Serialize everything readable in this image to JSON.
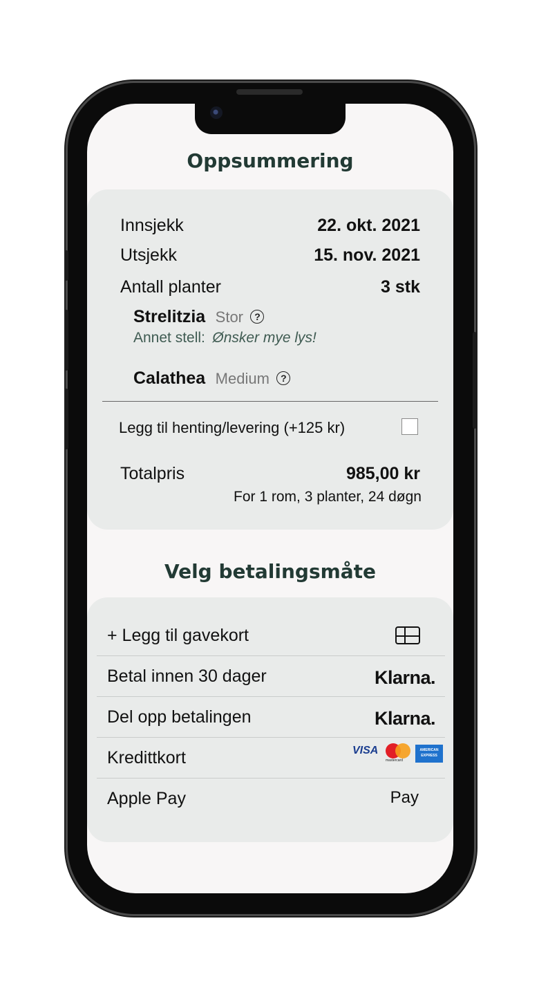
{
  "summary": {
    "title": "Oppsummering",
    "checkin_label": "Innsjekk",
    "checkin_value": "22. okt. 2021",
    "checkout_label": "Utsjekk",
    "checkout_value": "15. nov. 2021",
    "plants_label": "Antall planter",
    "plants_value": "3 stk",
    "plant1_name": "Strelitzia",
    "plant1_size": "Stor",
    "plant1_care_label": "Annet stell:",
    "plant1_care_value": "Ønsker mye lys!",
    "plant2_name": "Calathea",
    "plant2_size": "Medium",
    "help_glyph": "?",
    "pickup_label": "Legg til henting/levering (+125  kr)",
    "pickup_checked": false,
    "total_label": "Totalpris",
    "total_value": "985,00 kr",
    "total_detail": "For 1 rom, 3 planter, 24 døgn"
  },
  "payment": {
    "title": "Velg betalingsmåte",
    "giftcard_label": "+ Legg til gavekort",
    "pay30_label": "Betal innen 30 dager",
    "split_label": "Del opp betalingen",
    "credit_label": "Kredittkort",
    "applepay_label": "Apple Pay",
    "klarna_logo": "Klarna.",
    "visa_logo": "VISA",
    "mastercard_text": "mastercard",
    "amex_text": "AMERICAN EXPRESS",
    "applepay_logo": "Pay",
    "apple_glyph": ""
  }
}
